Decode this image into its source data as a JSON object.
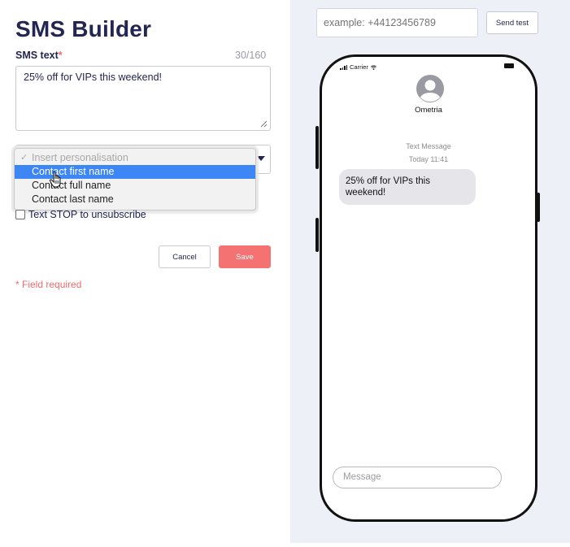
{
  "page": {
    "title": "SMS Builder"
  },
  "sms_text": {
    "label": "SMS text",
    "required_mark": "*",
    "counter": "30/160",
    "value": "25% off for VIPs this weekend!"
  },
  "personalisation": {
    "options": [
      {
        "label": "Insert personalisation",
        "placeholder": true,
        "checked": true
      },
      {
        "label": "Contact first name",
        "highlighted": true
      },
      {
        "label": "Contact full name"
      },
      {
        "label": "Contact last name"
      }
    ],
    "check_glyph": "✓"
  },
  "stop": {
    "label": "Text STOP to unsubscribe",
    "checked": false
  },
  "actions": {
    "cancel_label": "Cancel",
    "save_label": "Save"
  },
  "footer": {
    "field_required": "* Field required"
  },
  "test": {
    "phone_placeholder": "example: +44123456789",
    "send_label": "Send test"
  },
  "preview": {
    "carrier": "Carrier",
    "contact_name": "Ometria",
    "message_type": "Text Message",
    "timestamp": "Today 11:41",
    "message": "25% off for VIPs this weekend!",
    "input_placeholder": "Message"
  },
  "colors": {
    "primary_text": "#232552",
    "accent_required": "#f06b6b",
    "save_button": "#f57272",
    "dropdown_highlight": "#3d86f5",
    "preview_background": "#eef0f8",
    "bubble": "#e5e5ea"
  },
  "icons": {
    "resize": "resize-handle-icon",
    "dropdown_arrow": "triangle-down-icon",
    "cursor": "hand-pointer-icon",
    "avatar": "person-avatar-icon",
    "signal": "signal-bars-icon",
    "wifi": "wifi-icon",
    "battery": "battery-icon"
  }
}
